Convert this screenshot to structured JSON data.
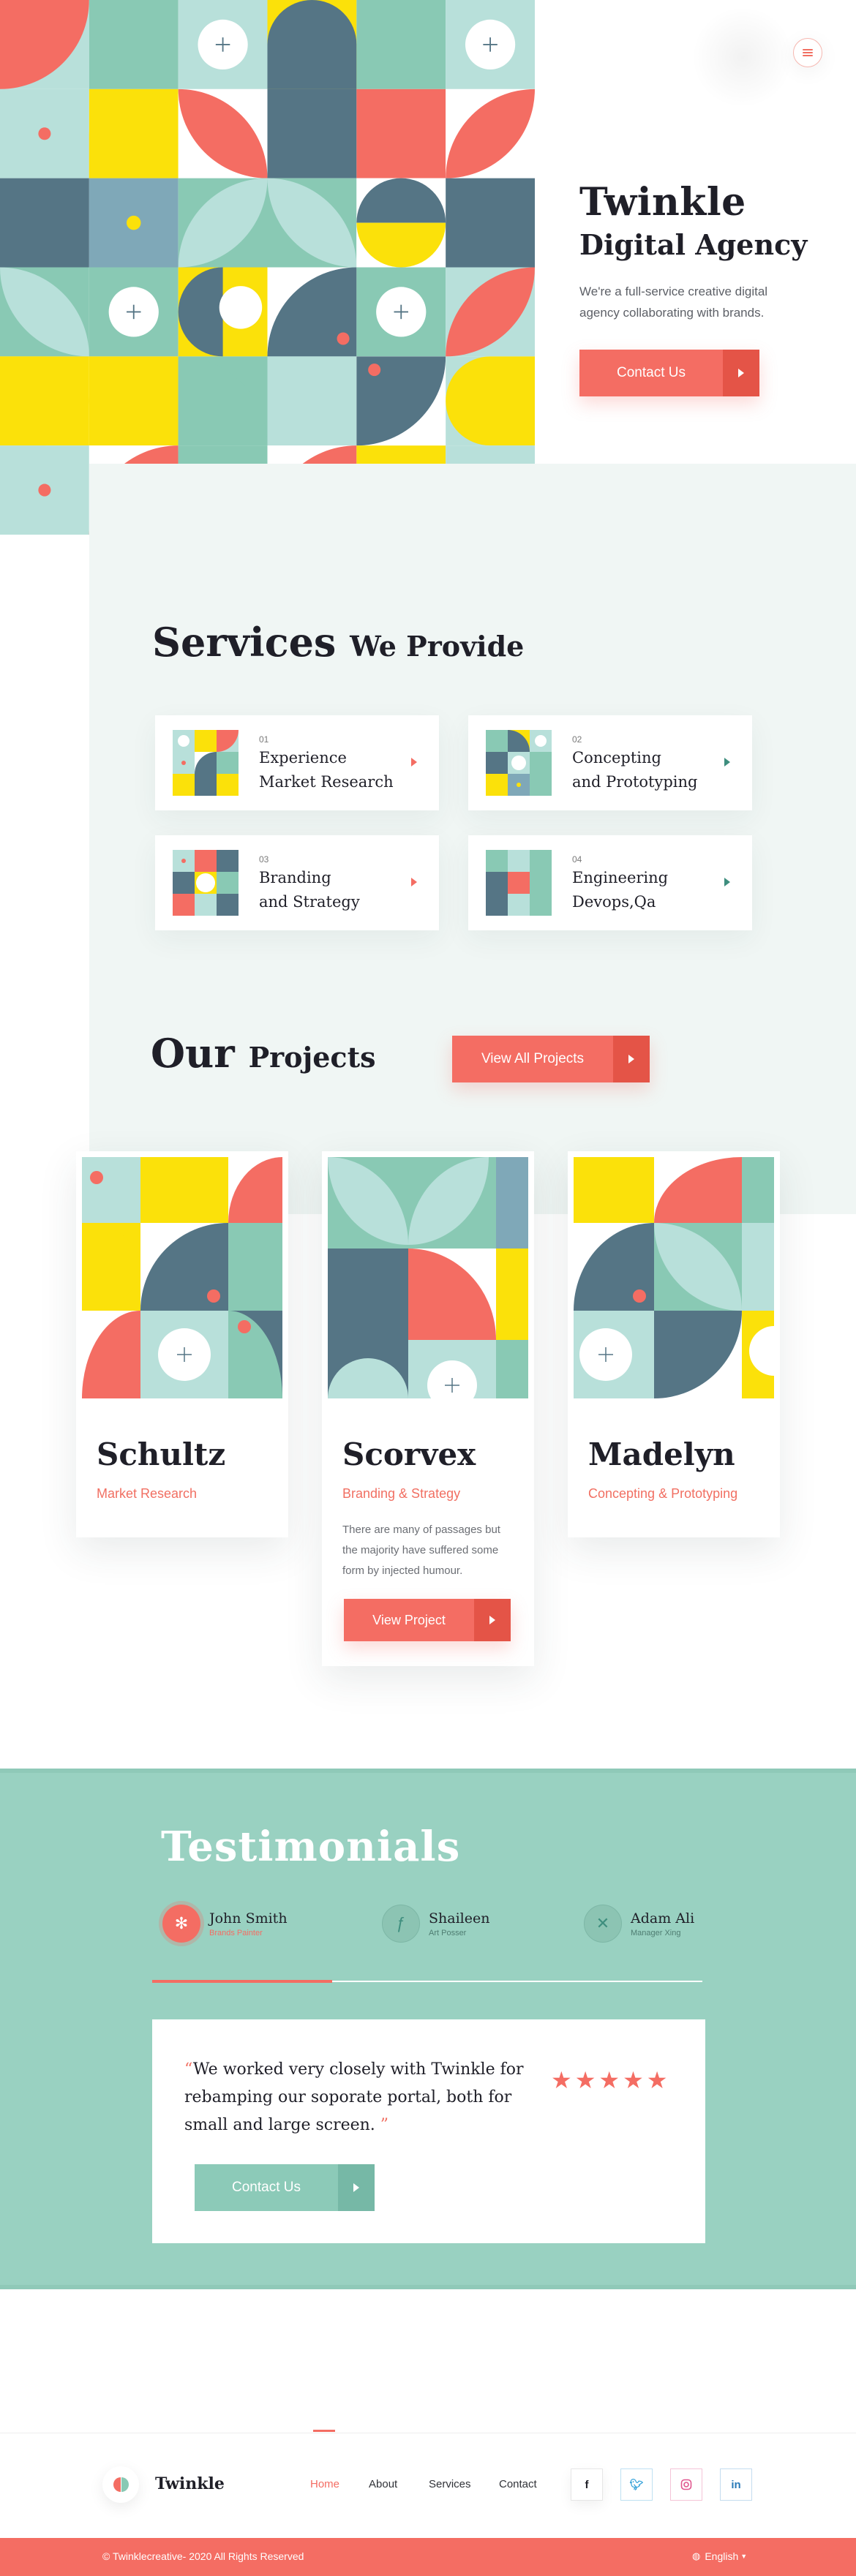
{
  "hero": {
    "title": "Twinkle",
    "subtitle": "Digital Agency",
    "description": "We're a full-service creative digital agency collaborating with brands.",
    "cta_label": "Contact Us"
  },
  "services": {
    "heading_strong": "Services",
    "heading_light": "We Provide",
    "items": [
      {
        "number": "01",
        "title_line1": "Experience",
        "title_line2": "Market Research"
      },
      {
        "number": "02",
        "title_line1": "Concepting",
        "title_line2": "and Prototyping"
      },
      {
        "number": "03",
        "title_line1": "Branding",
        "title_line2": "and Strategy"
      },
      {
        "number": "04",
        "title_line1": "Engineering",
        "title_line2": "Devops,Qa"
      }
    ]
  },
  "projects": {
    "heading_strong": "Our",
    "heading_light": "Projects",
    "view_all_label": "View All Projects",
    "items": [
      {
        "name": "Schultz",
        "category": "Market Research"
      },
      {
        "name": "Scorvex",
        "category": "Branding & Strategy",
        "description": "There are many of passages but the majority have suffered some form by injected humour.",
        "button_label": "View Project"
      },
      {
        "name": "Madelyn",
        "category": "Concepting & Prototyping"
      }
    ]
  },
  "testimonials": {
    "heading": "Testimonials",
    "people": [
      {
        "name": "John Smith",
        "role": "Brands Painter"
      },
      {
        "name": "Shaileen",
        "role": "Art Posser"
      },
      {
        "name": "Adam Ali",
        "role": "Manager Xing"
      }
    ],
    "quote": "We worked very closely with Twinkle for rebamping our soporate portal, both for small and large screen.",
    "quote_open": "“",
    "quote_close": "”",
    "stars": 5,
    "cta_label": "Contact Us"
  },
  "footer": {
    "brand": "Twinkle",
    "nav": [
      "Home",
      "About",
      "Services",
      "Contact"
    ],
    "social": [
      "f",
      "t",
      "ig",
      "in"
    ],
    "copyright": "© Twinklecreative- 2020 All Rights Reserved",
    "language": "English"
  },
  "colors": {
    "coral": "#f46d63",
    "yellow": "#fbe10a",
    "slate": "#557585",
    "mint": "#89c9b4",
    "pale_mint": "#b8e0da",
    "sky": "#7fa8b8"
  }
}
